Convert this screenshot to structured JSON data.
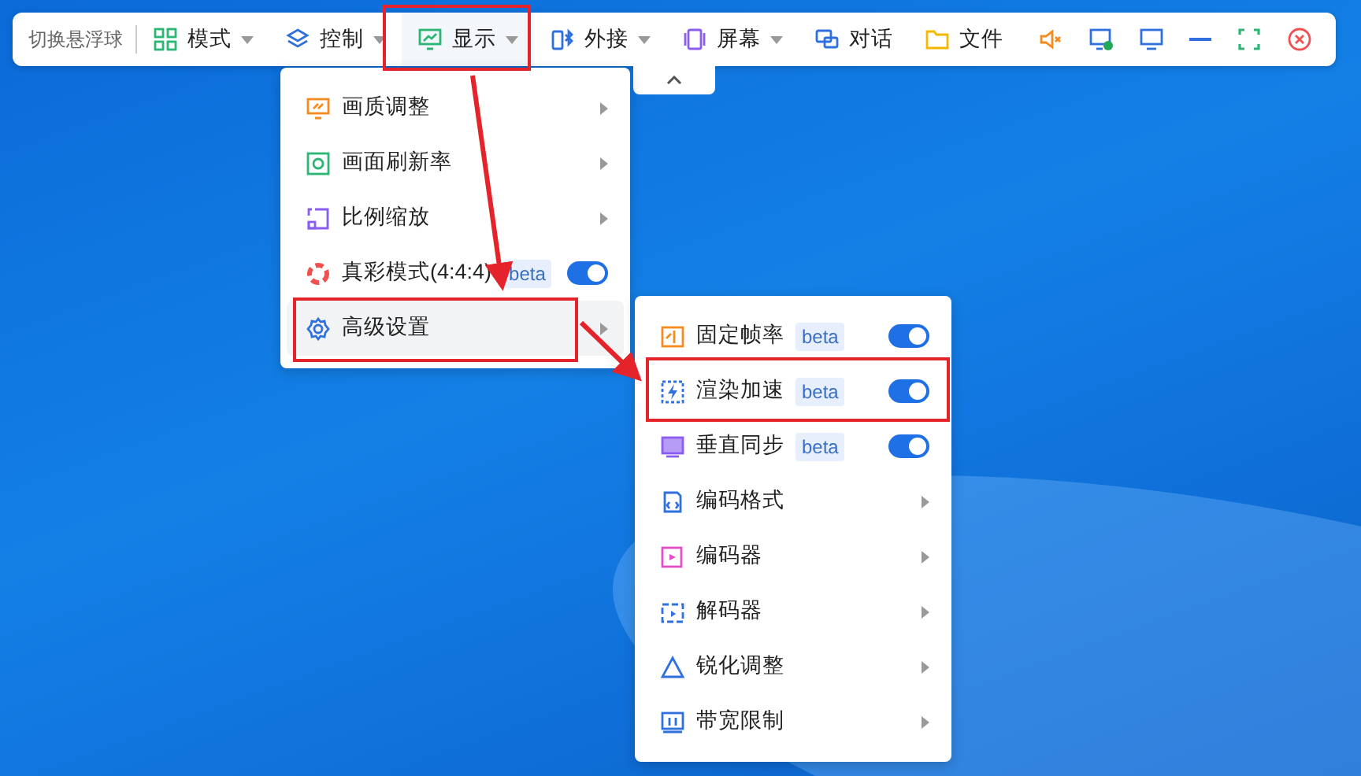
{
  "toolbar": {
    "float_toggle": "切换悬浮球",
    "menus": [
      {
        "label": "模式",
        "dropdown": true,
        "selected": false
      },
      {
        "label": "控制",
        "dropdown": true,
        "selected": false
      },
      {
        "label": "显示",
        "dropdown": true,
        "selected": true
      },
      {
        "label": "外接",
        "dropdown": true,
        "selected": false
      },
      {
        "label": "屏幕",
        "dropdown": true,
        "selected": false
      },
      {
        "label": "对话",
        "dropdown": false,
        "selected": false
      },
      {
        "label": "文件",
        "dropdown": false,
        "selected": false
      }
    ]
  },
  "display_menu": {
    "items": [
      {
        "kind": "submenu",
        "label": "画质调整",
        "selected": false
      },
      {
        "kind": "submenu",
        "label": "画面刷新率",
        "selected": false
      },
      {
        "kind": "submenu",
        "label": "比例缩放",
        "selected": false
      },
      {
        "kind": "toggle",
        "label": "真彩模式(4:4:4)",
        "badge": "beta",
        "on": true,
        "selected": false
      },
      {
        "kind": "submenu",
        "label": "高级设置",
        "selected": true
      }
    ]
  },
  "advanced_menu": {
    "items": [
      {
        "kind": "toggle",
        "label": "固定帧率",
        "badge": "beta",
        "on": true,
        "selected": false
      },
      {
        "kind": "toggle",
        "label": "渲染加速",
        "badge": "beta",
        "on": true,
        "selected": false
      },
      {
        "kind": "toggle",
        "label": "垂直同步",
        "badge": "beta",
        "on": true,
        "selected": false
      },
      {
        "kind": "submenu",
        "label": "编码格式",
        "selected": false
      },
      {
        "kind": "submenu",
        "label": "编码器",
        "selected": false
      },
      {
        "kind": "submenu",
        "label": "解码器",
        "selected": false
      },
      {
        "kind": "submenu",
        "label": "锐化调整",
        "selected": false
      },
      {
        "kind": "submenu",
        "label": "带宽限制",
        "selected": false
      }
    ]
  }
}
